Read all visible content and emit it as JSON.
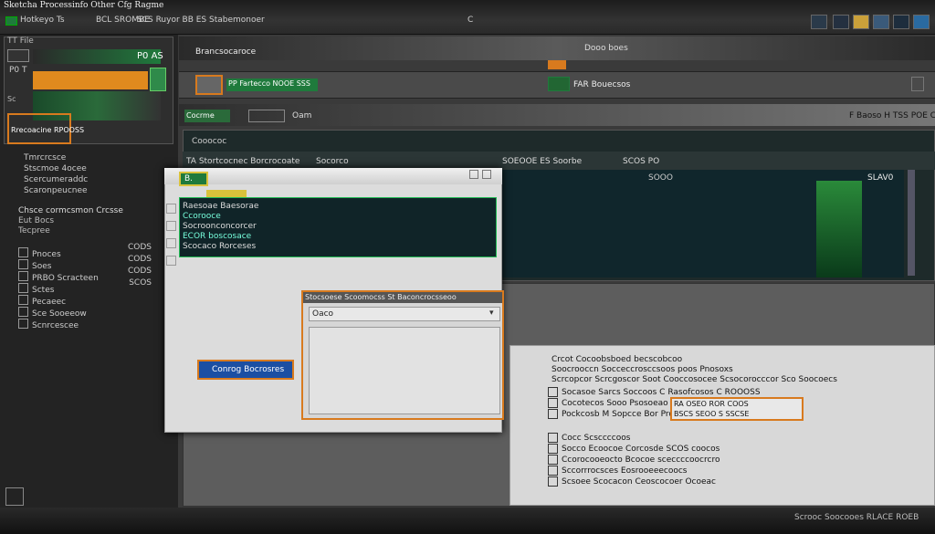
{
  "window": {
    "title": "Sketcha Processinfo Other Cfg Ragme"
  },
  "topbar": {
    "tabs": [
      "Hotkeyo Ts",
      "BCL SROMBE",
      "SCS Ruyor BB ES Stabemonoer",
      "C"
    ],
    "icons": [
      "monitor-icon",
      "chart-icon",
      "folder-icon",
      "user-icon",
      "display-icon",
      "globe-icon"
    ]
  },
  "left": {
    "header": "TT File",
    "badge": "P0 AS",
    "section": "P0 T",
    "selected": "Rrecoacine RPOOSS",
    "tree": [
      "Tmrcrcsce",
      "Stscmoe 4ocee",
      "Scercumeraddc",
      "Scaronpeucnee"
    ],
    "group_title": "Chsce cormcsmon Crcsse",
    "group_sub1": "Eut Bocs",
    "group_sub2": "Tecpree",
    "rows": [
      {
        "label": "Pnoces",
        "value": "CODS"
      },
      {
        "label": "Soes",
        "value": "CODS"
      },
      {
        "label": "PRBO Scracteen",
        "value": "CODS"
      },
      {
        "label": "Sctes",
        "value": "SCOS"
      },
      {
        "label": "Pecaeec",
        "value": ""
      },
      {
        "label": "Sce Sooeeow",
        "value": ""
      },
      {
        "label": "Scnrcescee",
        "value": ""
      }
    ]
  },
  "toolbar": {
    "title": "Brancsocaroce",
    "secondary": "Dooo boes",
    "row1_label": "PP Fartecco NOOE SSS",
    "row1_right": "FAR Bouecsos",
    "row2_label": "Cocrme",
    "row2_mid": "Oam",
    "row2_right": "F Baoso H TSS POE COS",
    "tab_label": "Cooococ"
  },
  "table": {
    "headers": [
      "TA Stortcocnec Borcrocoate",
      "Socorco",
      "SOEOOE ES Soorbe",
      "SCOS PO"
    ],
    "col_label": "SOOO",
    "right_value": "SLAV0"
  },
  "dialog": {
    "title": "B.",
    "list_items": [
      "Raesoae Baesorae",
      "Ccorooce",
      "Socroonconcorcer",
      "ECOR boscosace",
      "Scocaco Rorceses"
    ],
    "button": "Conrog Bocrosres",
    "sub_title": "Stocsoese Scoomocss St Baconcrocsseoo",
    "sub_select": "Oaco"
  },
  "bottom": {
    "heading1": "Crcot Cocoobsboed becscobcoo",
    "heading2": "Soocrooccn Socceccrosccsoos poos Pnosoxs",
    "heading3": "Scrcopcor Scrcgoscor Soot Cooccosocee Scsocorocccor Sco Soocoecs",
    "rows": [
      {
        "text": "Socasoe Sarcs Soccoos C Rasofcosos C ROOOSS",
        "value": ""
      },
      {
        "text": "Cocotecos Sooo Psosoeao",
        "value": "RA OSEO ROR COOS"
      },
      {
        "text": "Pockcosb M Sopcce Bor Proces",
        "value": "BSCS SEOO S SSCSE"
      }
    ],
    "list": [
      "Cocc Scsccccoos",
      "Socco Ecoocoe Corcosde SCOS coocos",
      "Ccorocooeocto Bcocoe sceccccoocrcro",
      "Sccorrrocsces Eosrooeeecoocs",
      "Scsoee Scocacon Ceoscocoer Ocoeac"
    ],
    "status": "Scrooc Soocooes RLACE ROEB"
  },
  "colors": {
    "accent_orange": "#d87a1e",
    "accent_green": "#1f7a3c",
    "accent_yellow": "#d9c23a",
    "accent_blue": "#1b4fa3"
  }
}
